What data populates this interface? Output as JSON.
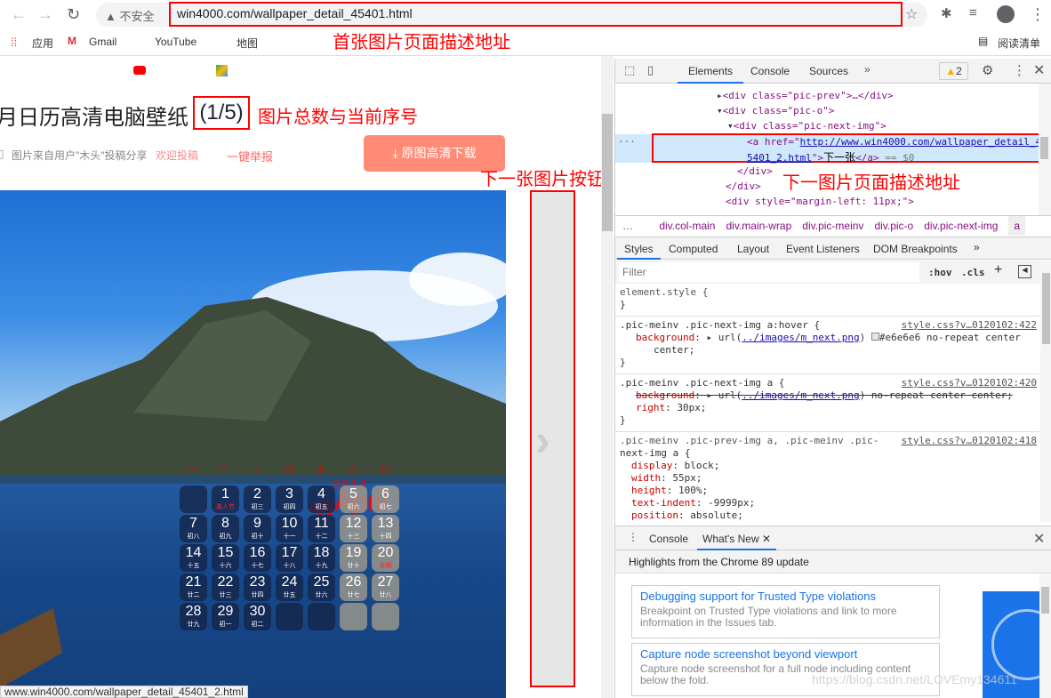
{
  "browser": {
    "url": "win4000.com/wallpaper_detail_45401.html",
    "security": "不安全",
    "bookmarks": [
      {
        "label": "应用",
        "icon": "apps-icon"
      },
      {
        "label": "Gmail",
        "icon": "gmail-icon"
      },
      {
        "label": "YouTube",
        "icon": "youtube-icon"
      },
      {
        "label": "地图",
        "icon": "maps-icon"
      }
    ],
    "reading_list": "阅读清单"
  },
  "page": {
    "title": "月日历高清电脑壁纸",
    "counter": "(1/5)",
    "source": "图片来自用户\"木头\"投稿分享",
    "contribute": "欢迎投稿",
    "report": "一键举报",
    "download": "原图高清下载",
    "status_url": "www.win4000.com/wallpaper_detail_45401_2.html",
    "calendar": {
      "year": "2014",
      "month_cn": "4月",
      "month_en": "April",
      "weekdays": [
        "一",
        "二",
        "三",
        "四",
        "五",
        "六",
        "日"
      ],
      "days": [
        [
          "",
          ""
        ],
        [
          "1",
          "愚人节"
        ],
        [
          "2",
          "初三"
        ],
        [
          "3",
          "初四"
        ],
        [
          "4",
          "初五"
        ],
        [
          "5",
          "初六"
        ],
        [
          "6",
          "初七"
        ],
        [
          "7",
          "初八"
        ],
        [
          "8",
          "初九"
        ],
        [
          "9",
          "初十"
        ],
        [
          "10",
          "十一"
        ],
        [
          "11",
          "十二"
        ],
        [
          "12",
          "十三"
        ],
        [
          "13",
          "十四"
        ],
        [
          "14",
          "十五"
        ],
        [
          "15",
          "十六"
        ],
        [
          "16",
          "十七"
        ],
        [
          "17",
          "十八"
        ],
        [
          "18",
          "十九"
        ],
        [
          "19",
          "廿十"
        ],
        [
          "20",
          "谷雨"
        ],
        [
          "21",
          "廿二"
        ],
        [
          "22",
          "廿三"
        ],
        [
          "23",
          "廿四"
        ],
        [
          "24",
          "廿五"
        ],
        [
          "25",
          "廿六"
        ],
        [
          "26",
          "廿七"
        ],
        [
          "27",
          "廿八"
        ],
        [
          "28",
          "廿九"
        ],
        [
          "29",
          "初一"
        ],
        [
          "30",
          "初二"
        ],
        [
          "",
          ""
        ],
        [
          "",
          ""
        ],
        [
          "",
          ""
        ],
        [
          "",
          ""
        ]
      ]
    }
  },
  "annotations": {
    "first_url": "首张图片页面描述地址",
    "counter": "图片总数与当前序号",
    "next_button": "下一张图片按钮",
    "next_url": "下一图片页面描述地址"
  },
  "devtools": {
    "tabs": [
      "Elements",
      "Console",
      "Sources"
    ],
    "warnings": "2",
    "dom": {
      "l1": "<div class=\"pic-prev\">…</div>",
      "l2": "<div class=\"pic-o\">",
      "l3": "<div class=\"pic-next-img\">",
      "a_open": "<a href=\"",
      "href1": "http://www.win4000.com/wallpaper_detail_4",
      "href2": "5401_2.html",
      "a_text": "下一张",
      "a_close": "</a>",
      "eq": " == $0",
      "c1": "</div>",
      "c2": "</div>",
      "l4": "<div style=\"margin-left: 11px;\">"
    },
    "breadcrumbs": [
      "div.col-main",
      "div.main-wrap",
      "div.pic-meinv",
      "div.pic-o",
      "div.pic-next-img",
      "a"
    ],
    "style_tabs": [
      "Styles",
      "Computed",
      "Layout",
      "Event Listeners",
      "DOM Breakpoints"
    ],
    "filter_placeholder": "Filter",
    "hov": ":hov",
    "cls": ".cls",
    "rules": {
      "r0": "element.style {",
      "r1_sel": ".pic-meinv .pic-next-img a:hover {",
      "r1_src": "style.css?v…0120102:422",
      "r1_prop": "background",
      "r1_url": "../images/m_next.png",
      "r1_rest": "#e6e6e6 no-repeat center",
      "r1_rest2": "center;",
      "r2_sel": ".pic-meinv .pic-next-img a {",
      "r2_src": "style.css?v…0120102:420",
      "r2_prop": "background",
      "r2_url": "../images/m_next.png",
      "r2_rest": ") no-repeat center center;",
      "r2_prop2": "right",
      "r2_val2": "30px;",
      "r3_sel1": ".pic-meinv .pic-prev-img a, .pic-meinv .pic-",
      "r3_sel2": "next-img a {",
      "r3_src": "style.css?v…0120102:418",
      "r3_props": [
        [
          "display",
          "block;"
        ],
        [
          "width",
          "55px;"
        ],
        [
          "height",
          "100%;"
        ],
        [
          "text-indent",
          "-9999px;"
        ],
        [
          "position",
          "absolute;"
        ]
      ]
    },
    "drawer": {
      "tabs": [
        "Console",
        "What's New"
      ],
      "headline": "Highlights from the Chrome 89 update",
      "cards": [
        {
          "title": "Debugging support for Trusted Type violations",
          "desc": "Breakpoint on Trusted Type violations and link to more information in the Issues tab."
        },
        {
          "title": "Capture node screenshot beyond viewport",
          "desc": "Capture node screenshot for a full node including content below the fold."
        }
      ]
    }
  },
  "watermark": "https://blog.csdn.net/LOVEmy134611"
}
